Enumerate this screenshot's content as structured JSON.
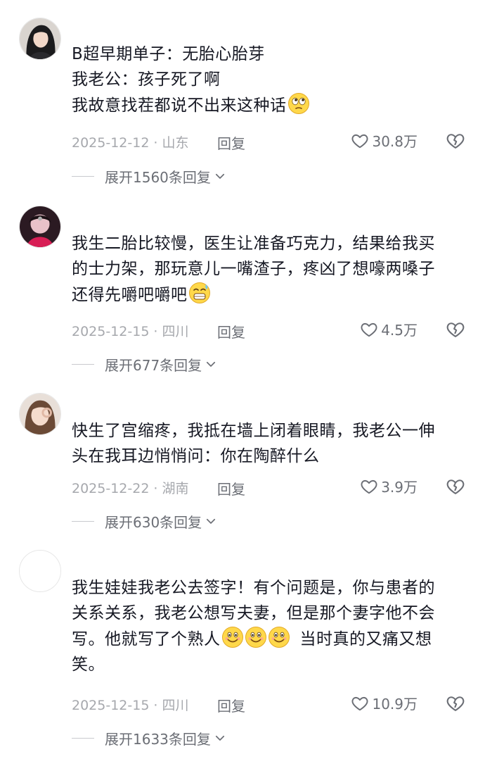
{
  "comments": [
    {
      "lines": [
        "B超早期单子：无胎心胎芽",
        "我老公：孩子死了啊",
        "我故意找茬都说不出来这种话"
      ],
      "emoji": [
        "rolling-eyes-emoji"
      ],
      "date": "2025-12-12",
      "location": "山东",
      "reply_label": "回复",
      "likes": "30.8万",
      "expand_label": "展开1560条回复"
    },
    {
      "lines": [
        "我生二胎比较慢，医生让准备巧克力，结果给我买",
        "的士力架，那玩意儿一嘴渣子，疼凶了想嚎两嗓子",
        "还得先嚼吧嚼吧"
      ],
      "emoji": [
        "grimace-sweat-emoji"
      ],
      "date": "2025-12-15",
      "location": "四川",
      "reply_label": "回复",
      "likes": "4.5万",
      "expand_label": "展开677条回复"
    },
    {
      "lines": [
        "快生了宫缩疼，我抵在墙上闭着眼睛，我老公一伸",
        "头在我耳边悄悄问：你在陶醉什么"
      ],
      "emoji": [],
      "date": "2025-12-22",
      "location": "湖南",
      "reply_label": "回复",
      "likes": "3.9万",
      "expand_label": "展开630条回复"
    },
    {
      "lines": [
        "我生娃娃我老公去签字！有个问题是，你与患者的",
        "关系关系，我老公想写夫妻，但是那个妻字他不会",
        "写。他就写了个熟人",
        "当时真的又痛又想",
        "笑。"
      ],
      "emoji": [
        "smile-emoji",
        "smile-emoji",
        "smile-emoji"
      ],
      "date": "2025-12-15",
      "location": "四川",
      "reply_label": "回复",
      "likes": "10.9万",
      "expand_label": "展开1633条回复"
    }
  ],
  "icons": {
    "like": "heart-outline-icon",
    "dislike": "broken-heart-icon",
    "expand": "chevron-down-icon"
  },
  "colors": {
    "text": "#161823",
    "meta": "#a6a8ad",
    "secondary": "#6b6e75"
  }
}
